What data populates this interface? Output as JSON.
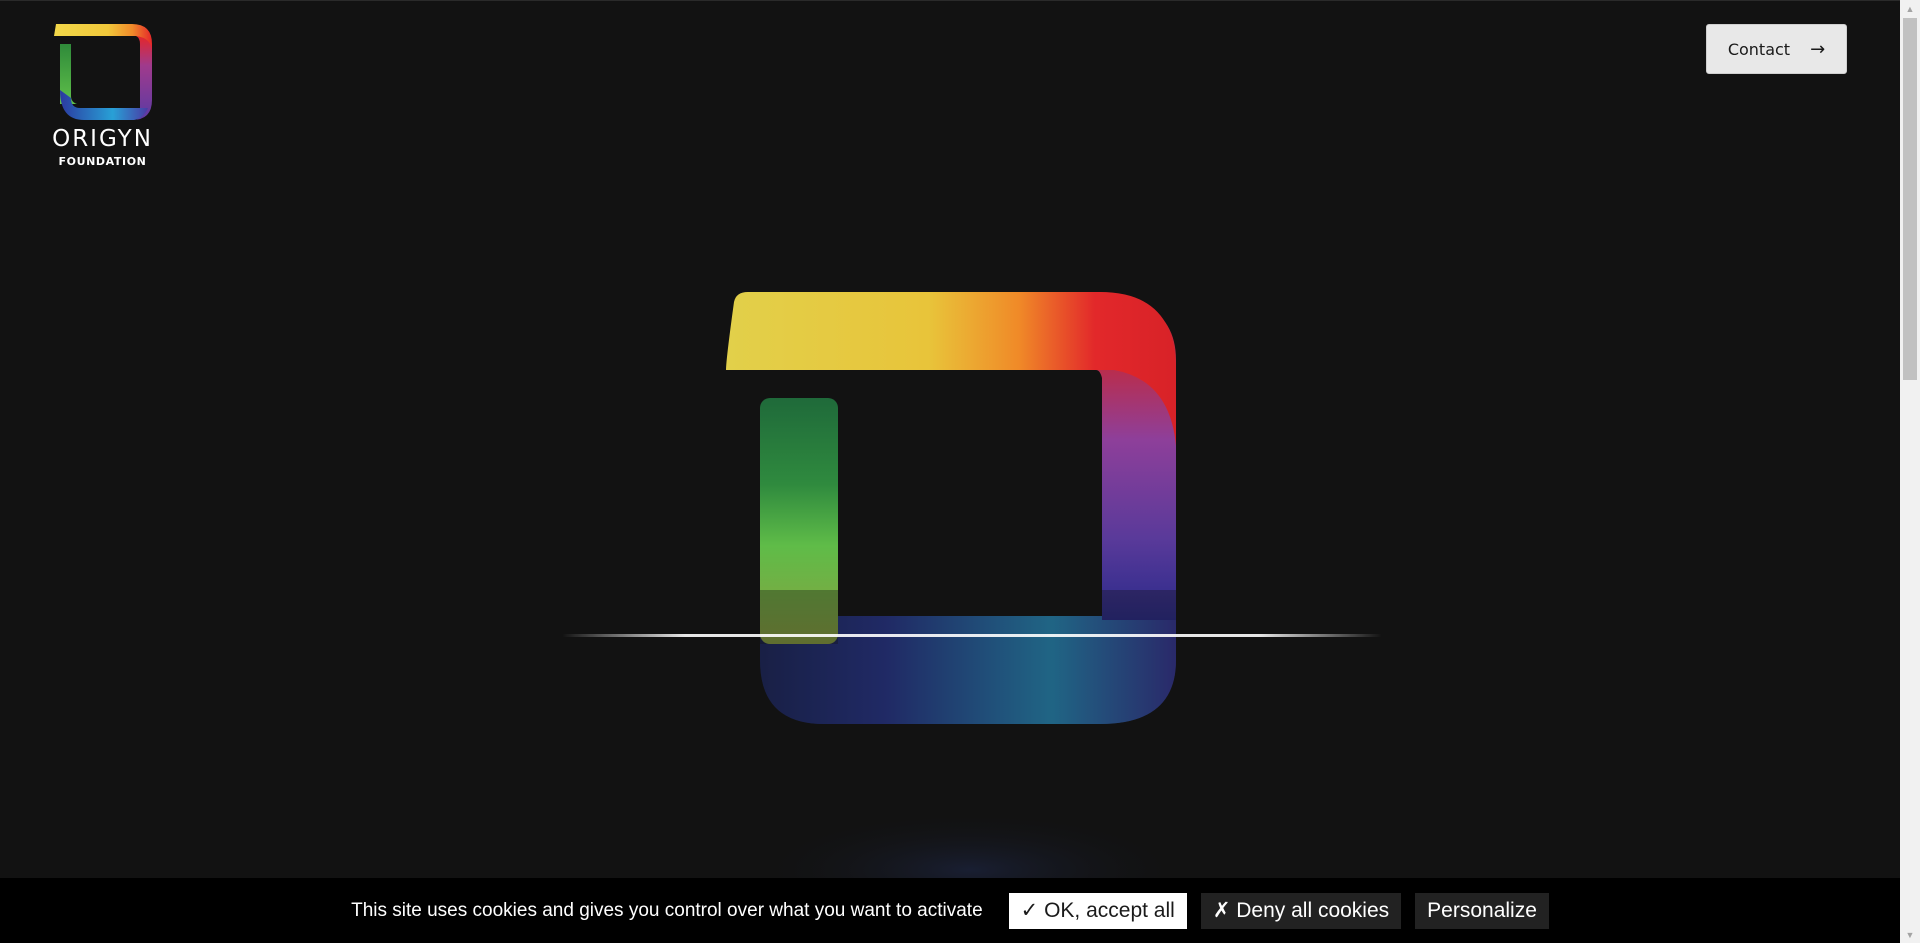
{
  "header": {
    "logo": {
      "word": "ORIGYN",
      "sub": "FOUNDATION",
      "icon": "origyn-logo-icon"
    },
    "contact": {
      "label": "Contact",
      "icon": "arrow-right-icon"
    }
  },
  "hero": {
    "icon": "origyn-hero-emblem"
  },
  "cookie_bar": {
    "message": "This site uses cookies and gives you control over what you want to activate",
    "accept_label": "✓ OK, accept all",
    "deny_label": "✗ Deny all cookies",
    "personalize_label": "Personalize"
  },
  "scrollbar": {
    "up_icon": "▲",
    "down_icon": "▼"
  },
  "colors": {
    "background": "#121212",
    "yellow": "#e6cf45",
    "red": "#e02a2a",
    "purple": "#8e3f9a",
    "green": "#4cae3e",
    "blue": "#2c5fb8"
  }
}
